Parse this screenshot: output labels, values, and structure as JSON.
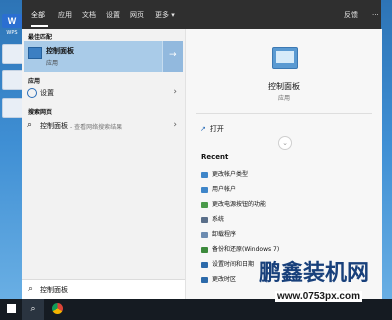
{
  "tabs": {
    "all": "全部",
    "apps": "应用",
    "docs": "文档",
    "settings": "设置",
    "web": "网页",
    "more": "更多",
    "feedback": "反馈",
    "ellipsis": "···"
  },
  "left": {
    "best_match_title": "最佳匹配",
    "best_item": {
      "label": "控制面板",
      "sub": "应用"
    },
    "apps_title": "应用",
    "app_item": {
      "label": "设置"
    },
    "web_title": "搜索网页",
    "web_item": {
      "label": "控制面板",
      "sub": "- 查看网络搜索结果"
    }
  },
  "right": {
    "title": "控制面板",
    "subtitle": "应用",
    "open": "打开",
    "recent_title": "Recent",
    "recent_items": [
      "更改帐户类型",
      "用户帐户",
      "更改电源按钮的功能",
      "系统",
      "卸载程序",
      "备份和还原(Windows 7)",
      "设置时间和日期",
      "更改时区"
    ]
  },
  "search": {
    "value": "控制面板"
  },
  "desktop": {
    "brand_label": "WPS"
  },
  "watermark": {
    "text": "鹏鑫装机网",
    "url": "www.0753px.com"
  }
}
